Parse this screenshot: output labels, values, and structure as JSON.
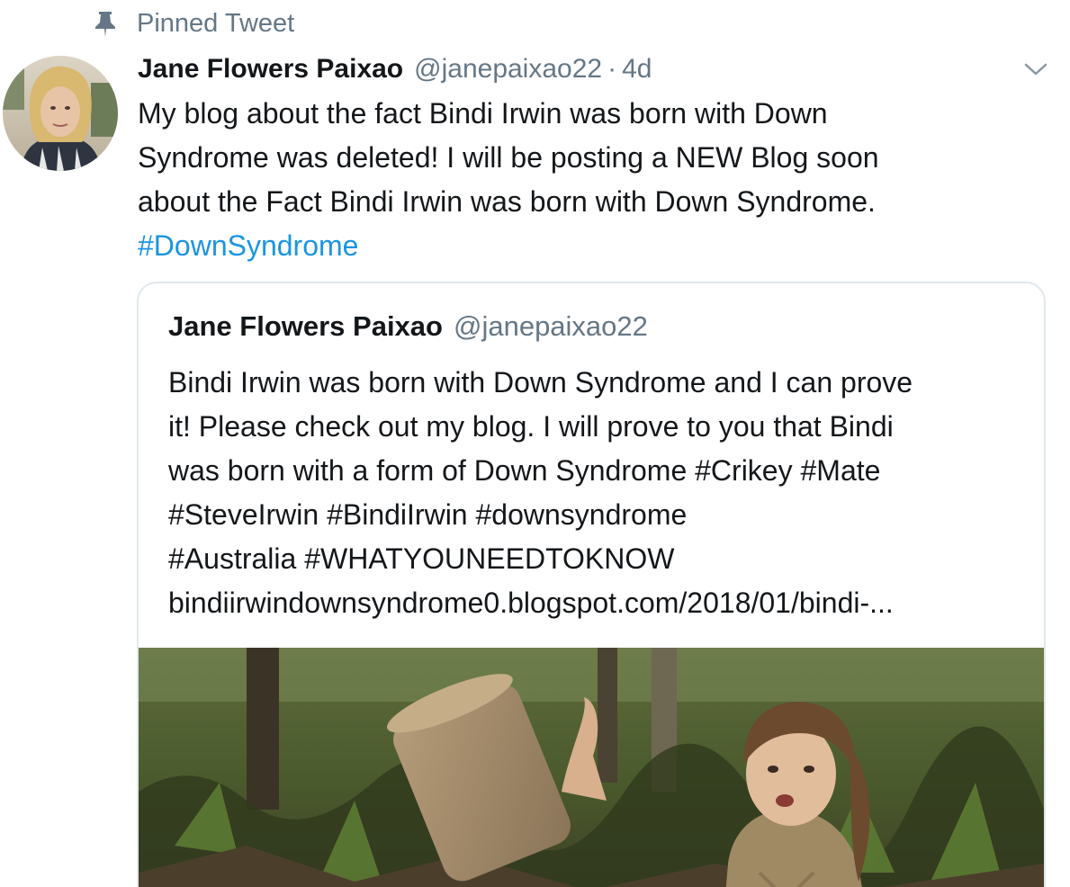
{
  "pinned": {
    "icon": "pin-icon",
    "label": "Pinned Tweet"
  },
  "tweet": {
    "display_name": "Jane Flowers Paixao",
    "handle": "@janepaixao22",
    "separator": "·",
    "time": "4d",
    "menu_icon": "chevron-down-icon",
    "text_lines": [
      "My blog about the fact Bindi Irwin was born with Down",
      "Syndrome was deleted! I will be posting a NEW Blog soon",
      "about the Fact Bindi Irwin was born with Down Syndrome."
    ],
    "hashtag": "#DownSyndrome"
  },
  "quoted_tweet": {
    "display_name": "Jane Flowers Paixao",
    "handle": "@janepaixao22",
    "text_lines": [
      "Bindi Irwin was born with Down Syndrome and I can prove",
      "it! Please check out my blog.  I will prove to you that Bindi",
      "was born with a form of Down Syndrome #Crikey #Mate",
      "#SteveIrwin #BindiIrwin #downsyndrome",
      "#Australia #WHATYOUNEEDTOKNOW",
      "bindiirwindownsyndrome0.blogspot.com/2018/01/bindi-..."
    ]
  },
  "colors": {
    "text": "#14171a",
    "muted": "#657786",
    "link": "#1b95e0",
    "border": "#e1e8ed"
  }
}
